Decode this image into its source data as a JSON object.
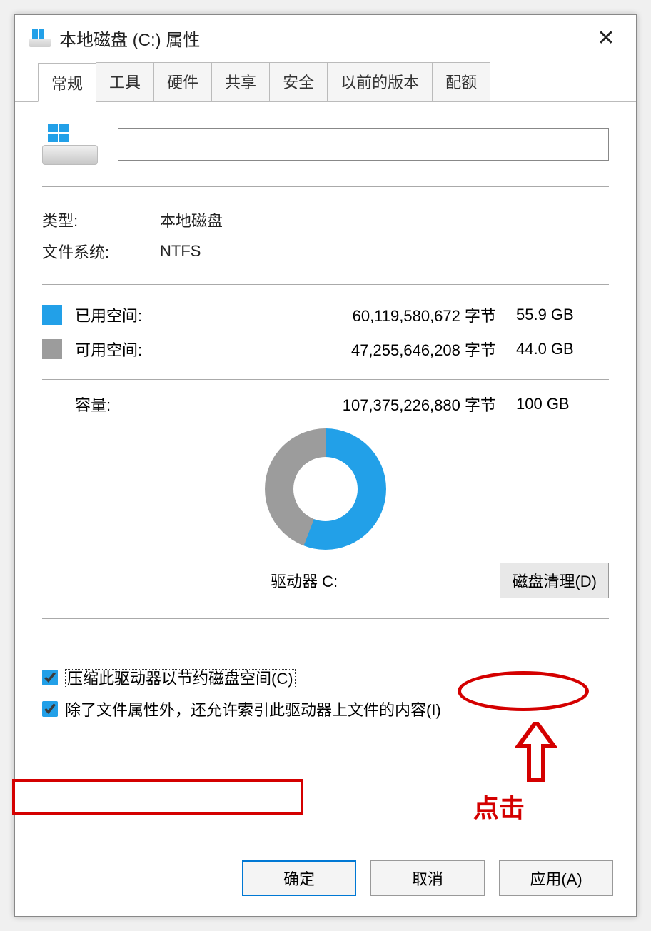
{
  "window": {
    "title": "本地磁盘 (C:) 属性"
  },
  "tabs": [
    {
      "label": "常规",
      "active": true
    },
    {
      "label": "工具",
      "active": false
    },
    {
      "label": "硬件",
      "active": false
    },
    {
      "label": "共享",
      "active": false
    },
    {
      "label": "安全",
      "active": false
    },
    {
      "label": "以前的版本",
      "active": false
    },
    {
      "label": "配额",
      "active": false
    }
  ],
  "general": {
    "volume_name": "",
    "type_label": "类型:",
    "type_value": "本地磁盘",
    "fs_label": "文件系统:",
    "fs_value": "NTFS",
    "used_label": "已用空间:",
    "used_bytes": "60,119,580,672 字节",
    "used_gb": "55.9 GB",
    "free_label": "可用空间:",
    "free_bytes": "47,255,646,208 字节",
    "free_gb": "44.0 GB",
    "capacity_label": "容量:",
    "capacity_bytes": "107,375,226,880 字节",
    "capacity_gb": "100 GB",
    "drive_caption": "驱动器 C:",
    "disk_cleanup": "磁盘清理(D)",
    "compress_label": "压缩此驱动器以节约磁盘空间(C)",
    "index_label": "除了文件属性外，还允许索引此驱动器上文件的内容(I)",
    "compress_checked": true,
    "index_checked": true
  },
  "buttons": {
    "ok": "确定",
    "cancel": "取消",
    "apply": "应用(A)"
  },
  "annotations": {
    "click_text": "点击"
  },
  "chart_data": {
    "type": "pie",
    "title": "驱动器 C:",
    "series": [
      {
        "name": "已用空间",
        "value_bytes": 60119580672,
        "value_gb": 55.9,
        "color": "#22a0e8"
      },
      {
        "name": "可用空间",
        "value_bytes": 47255646208,
        "value_gb": 44.0,
        "color": "#9c9c9c"
      }
    ],
    "total_bytes": 107375226880,
    "total_gb": 100
  }
}
